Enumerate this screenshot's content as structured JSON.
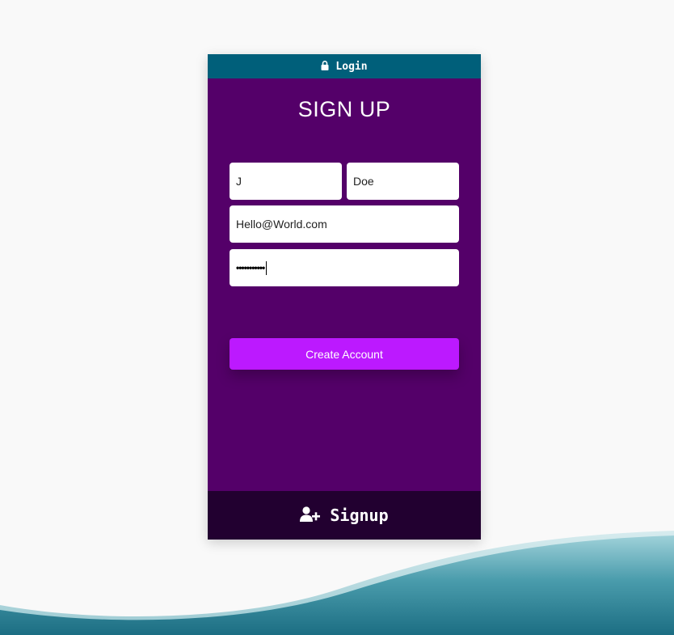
{
  "login_tab": {
    "icon": "lock-icon",
    "label": "Login"
  },
  "form": {
    "title": "SIGN UP",
    "first_name_value": "J",
    "last_name_value": "Doe",
    "email_value": "Hello@World.com",
    "password_mask": "•••••••••••",
    "submit_label": "Create Account"
  },
  "signup_tab": {
    "icon": "user-plus-icon",
    "label": "Signup"
  },
  "colors": {
    "page_background": "#f9f9f9",
    "card_background": "#540069",
    "login_bar": "#005f7a",
    "signup_bar": "#220030",
    "button": "#bc19ff",
    "wave": "#3f93a3"
  }
}
